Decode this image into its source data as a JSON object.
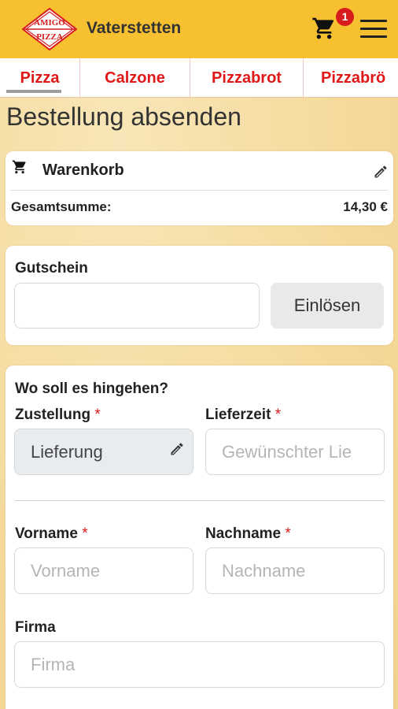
{
  "header": {
    "logo_top": "AMIGO",
    "logo_bottom": "PIZZA",
    "city": "Vaterstetten",
    "cart_count": "1",
    "brand_color": "#f7c030",
    "badge_color": "#d61c1c"
  },
  "tabs": [
    {
      "label": "Pizza"
    },
    {
      "label": "Calzone"
    },
    {
      "label": "Pizzabrot"
    },
    {
      "label": "Pizzabrö"
    }
  ],
  "page_title": "Bestellung absenden",
  "cart": {
    "title": "Warenkorb",
    "total_label": "Gesamtsumme:",
    "total_value": "14,30 €"
  },
  "voucher": {
    "label": "Gutschein",
    "value": "",
    "button": "Einlösen"
  },
  "delivery": {
    "heading": "Wo soll es hingehen?",
    "zustellung_label": "Zustellung",
    "zustellung_value": "Lieferung",
    "lieferzeit_label": "Lieferzeit",
    "lieferzeit_placeholder": "Gewünschter Lie",
    "required_mark": "*"
  },
  "person": {
    "vorname_label": "Vorname",
    "vorname_placeholder": "Vorname",
    "nachname_label": "Nachname",
    "nachname_placeholder": "Nachname",
    "firma_label": "Firma",
    "firma_placeholder": "Firma"
  }
}
